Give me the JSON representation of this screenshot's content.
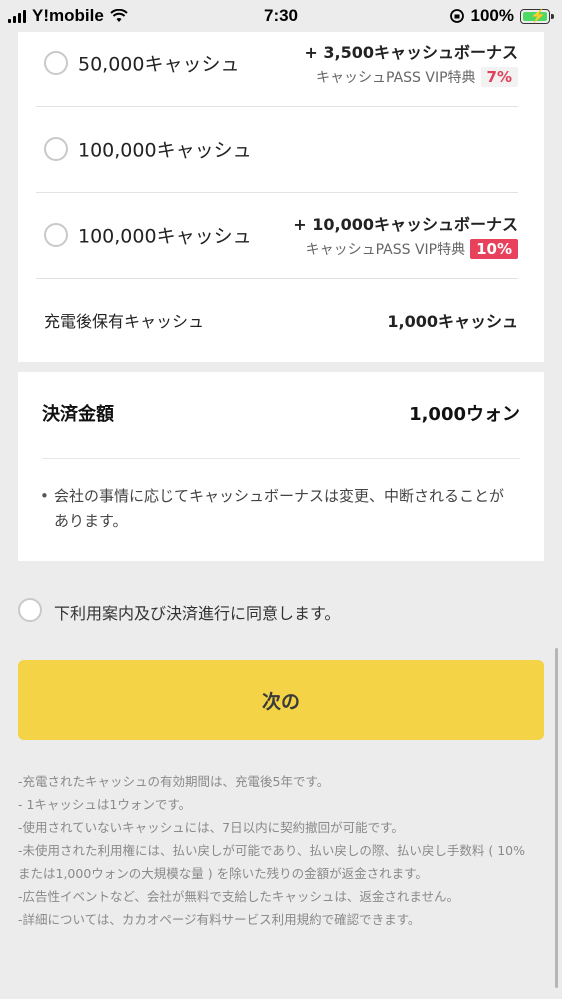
{
  "status_bar": {
    "carrier": "Y!mobile",
    "time": "7:30",
    "battery_percent": "100%"
  },
  "options": [
    {
      "label": "50,000キャッシュ",
      "bonus": "+ 3,500キャッシュボーナス",
      "vip": "キャッシュPASS VIP特典",
      "rate": "7%"
    },
    {
      "label": "100,000キャッシュ"
    },
    {
      "label": "100,000キャッシュ",
      "bonus": "+ 10,000キャッシュボーナス",
      "vip": "キャッシュPASS VIP特典",
      "rate": "10%"
    }
  ],
  "after_charge": {
    "label": "充電後保有キャッシュ",
    "value": "1,000キャッシュ"
  },
  "payment": {
    "label": "決済金額",
    "value": "1,000ウォン",
    "notice": "会社の事情に応じてキャッシュボーナスは変更、中断されることがあります。"
  },
  "agree_text": "下利用案内及び決済進行に同意します。",
  "next_label": "次の",
  "terms": [
    "-充電されたキャッシュの有効期間は、充電後5年です。",
    "- 1キャッシュは1ウォンです。",
    "-使用されていないキャッシュには、7日以内に契約撤回が可能です。",
    "-未使用された利用権には、払い戻しが可能であり、払い戻しの際、払い戻し手数料 ( 10%",
    "または1,000ウォンの大規模な量 ) を除いた残りの金額が返金されます。",
    "-広告性イベントなど、会社が無料で支給したキャッシュは、返金されません。",
    "-詳細については、カカオページ有料サービス利用規約で確認できます。"
  ],
  "colors": {
    "accent_yellow": "#f4d347",
    "rate_red": "#e8415c",
    "background": "#ececec"
  }
}
